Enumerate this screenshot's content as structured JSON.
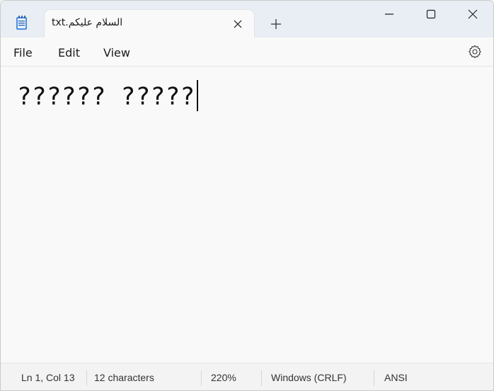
{
  "tab": {
    "title": "السلام عليكم.txt"
  },
  "menu": {
    "items": [
      "File",
      "Edit",
      "View"
    ]
  },
  "editor": {
    "content": "?????? ?????"
  },
  "status": {
    "position": "Ln 1, Col 13",
    "characters": "12 characters",
    "zoom": "220%",
    "line_ending": "Windows (CRLF)",
    "encoding": "ANSI"
  },
  "icons": {
    "app": "notepad-icon",
    "close_tab": "close-icon",
    "new_tab": "plus-icon",
    "minimize": "minimize-icon",
    "maximize": "maximize-icon",
    "close_window": "close-icon",
    "settings": "gear-icon"
  },
  "colors": {
    "titlebar": "#e9eef4",
    "editor_bg": "#f9f9f9",
    "accent": "#2a6fd6"
  }
}
